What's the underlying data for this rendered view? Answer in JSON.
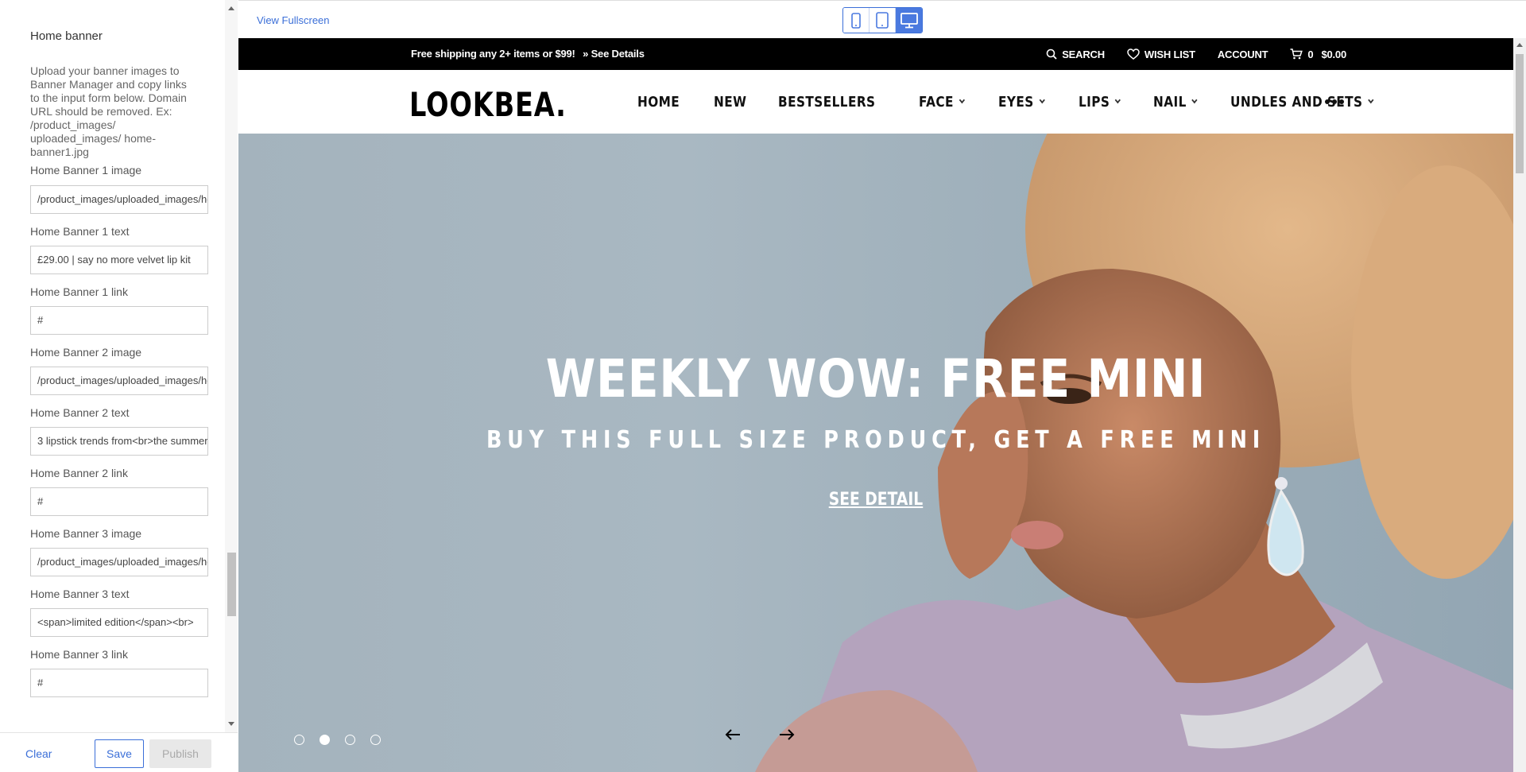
{
  "editor": {
    "section_title": "Home banner",
    "section_description": "Upload your banner images to\nBanner Manager and copy links\nto the input form below. Domain\nURL should be removed. Ex:\n/product_images/\nuploaded_images/ home-\nbanner1.jpg",
    "fields": [
      {
        "label": "Home Banner 1 image",
        "value": "/product_images/uploaded_images/home-banner1.jpg"
      },
      {
        "label": "Home Banner 1 text",
        "value": "£29.00 | say no more velvet lip kit"
      },
      {
        "label": "Home Banner 1 link",
        "value": "#"
      },
      {
        "label": "Home Banner 2 image",
        "value": "/product_images/uploaded_images/home-banner2.jpg"
      },
      {
        "label": "Home Banner 2 text",
        "value": "3 lipstick trends from<br>the summer"
      },
      {
        "label": "Home Banner 2 link",
        "value": "#"
      },
      {
        "label": "Home Banner 3 image",
        "value": "/product_images/uploaded_images/home-banner3.jpg"
      },
      {
        "label": "Home Banner 3 text",
        "value": "<span>limited edition</span><br>"
      },
      {
        "label": "Home Banner 3 link",
        "value": "#"
      }
    ],
    "footer": {
      "clear": "Clear",
      "save": "Save",
      "publish": "Publish"
    }
  },
  "preview": {
    "view_fullscreen": "View Fullscreen",
    "device_modes": [
      "mobile-icon",
      "tablet-icon",
      "desktop-icon"
    ],
    "active_device": "desktop",
    "accent_color": "#4a79df"
  },
  "site": {
    "topbar": {
      "shipping": "Free shipping any 2+ items or $99!",
      "see_details": "» See Details",
      "search": "SEARCH",
      "wishlist": "WISH LIST",
      "account": "ACCOUNT",
      "cart_count": "0",
      "cart_total": "$0.00"
    },
    "logo": "LOOKBEA.",
    "menu": [
      {
        "label": "HOME",
        "has_dropdown": false
      },
      {
        "label": "NEW",
        "has_dropdown": false
      },
      {
        "label": "BESTSELLERS",
        "has_dropdown": false
      },
      {
        "label": "FACE",
        "has_dropdown": true
      },
      {
        "label": "EYES",
        "has_dropdown": true
      },
      {
        "label": "LIPS",
        "has_dropdown": true
      },
      {
        "label": "NAIL",
        "has_dropdown": true
      },
      {
        "label": "UNDLES AND SETS",
        "has_dropdown": true
      }
    ],
    "hero": {
      "title": "WEEKLY WOW: FREE MINI",
      "subtitle": "BUY THIS FULL SIZE PRODUCT, GET A FREE MINI",
      "cta": "SEE DETAIL",
      "slide_count": 4,
      "active_slide": 2
    }
  }
}
